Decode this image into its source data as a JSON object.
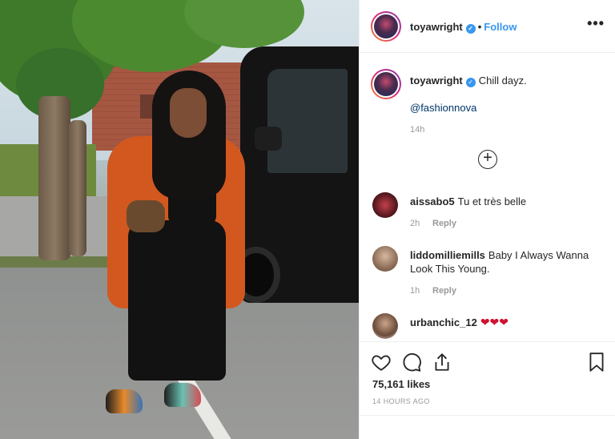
{
  "post": {
    "username": "toyawright",
    "verified": true,
    "follow_label": "Follow",
    "dot": "•",
    "more_icon": "•••",
    "caption": "Chill dayz.",
    "mention": "@fashionnova",
    "caption_time": "14h",
    "load_more_icon": "+"
  },
  "comments": [
    {
      "user": "aissabo5",
      "text": "Tu et très belle",
      "time": "2h",
      "reply_label": "Reply"
    },
    {
      "user": "liddomilliemills",
      "text": "Baby I Always Wanna Look This Young.",
      "time": "1h",
      "reply_label": "Reply"
    },
    {
      "user": "urbanchic_12",
      "text": "❤❤❤"
    }
  ],
  "stats": {
    "likes": "75,161 likes",
    "posted": "14 HOURS AGO"
  },
  "icons": {
    "like": "heart-icon",
    "comment": "comment-icon",
    "share": "share-icon",
    "save": "bookmark-icon",
    "verified": "verified-badge-icon"
  },
  "colors": {
    "link": "#3897f0",
    "mention": "#003569",
    "muted": "#999999",
    "heart": "#d10f2f"
  }
}
